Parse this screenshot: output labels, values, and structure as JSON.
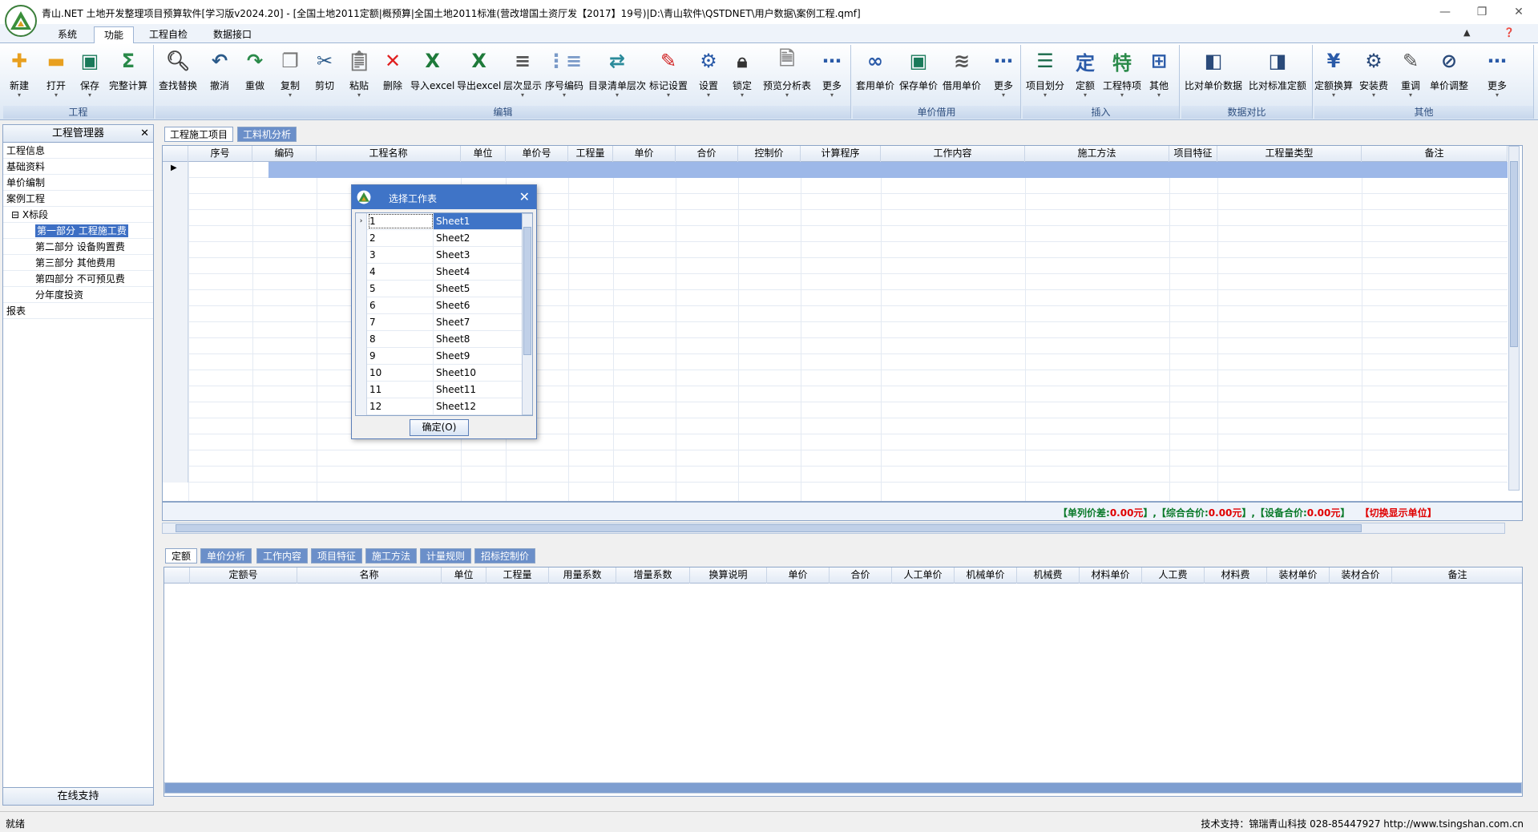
{
  "window": {
    "title": "青山.NET 土地开发整理项目预算软件[学习版v2024.20] - [全国土地2011定额|概预算|全国土地2011标准(营改增国土资厅发【2017】19号)|D:\\青山软件\\QSTDNET\\用户数据\\案例工程.qmf]",
    "minimize": "—",
    "restore": "❐",
    "close": "✕"
  },
  "menu": {
    "tabs": [
      "系统",
      "功能",
      "工程自检",
      "数据接口"
    ],
    "active": "功能",
    "right_up": "▲",
    "right_info": "❓"
  },
  "ribbon": {
    "groups": [
      {
        "label": "工程",
        "buttons": [
          "新建",
          "打开",
          "保存",
          "完整计算"
        ]
      },
      {
        "label": "编辑",
        "buttons": [
          "查找替换",
          "撤消",
          "重做",
          "复制",
          "剪切",
          "粘贴",
          "删除",
          "导入excel",
          "导出excel",
          "层次显示",
          "序号编码",
          "目录清单层次",
          "标记设置",
          "设置",
          "锁定",
          "预览分析表",
          "更多"
        ]
      },
      {
        "label": "单价借用",
        "buttons": [
          "套用单价",
          "保存单价",
          "借用单价",
          "更多"
        ]
      },
      {
        "label": "插入",
        "buttons": [
          "项目划分",
          "定额",
          "工程特项",
          "其他"
        ]
      },
      {
        "label": "数据对比",
        "buttons": [
          "比对单价数据",
          "比对标准定额"
        ]
      },
      {
        "label": "其他",
        "buttons": [
          "定额换算",
          "安装费",
          "重调",
          "单价调整",
          "更多"
        ]
      }
    ]
  },
  "left_panel": {
    "title": "工程管理器",
    "close": "✕",
    "items": [
      {
        "label": "工程信息",
        "level": 0
      },
      {
        "label": "基础资料",
        "level": 0
      },
      {
        "label": "单价编制",
        "level": 0
      },
      {
        "label": "案例工程",
        "level": 0
      },
      {
        "label": "⊟ X标段",
        "level": 0
      },
      {
        "label": "第一部分 工程施工费",
        "level": 1,
        "selected": true
      },
      {
        "label": "第二部分 设备购置费",
        "level": 1
      },
      {
        "label": "第三部分 其他费用",
        "level": 1
      },
      {
        "label": "第四部分 不可预见费",
        "level": 1
      },
      {
        "label": "分年度投资",
        "level": 1
      },
      {
        "label": "报表",
        "level": 0
      }
    ],
    "footer": "在线支持"
  },
  "doc_tabs": [
    "工程施工项目",
    "工料机分析"
  ],
  "upper_grid": {
    "columns": [
      "序号",
      "编码",
      "工程名称",
      "单位",
      "单价号",
      "工程量",
      "单价",
      "合价",
      "控制价",
      "计算程序",
      "工作内容",
      "施工方法",
      "项目特征",
      "工程量类型",
      "备注"
    ],
    "current_row_marker": "▶"
  },
  "summary": {
    "part1_label": "【单列价差:",
    "part1_value": "0.00元",
    "part2_label": "】,【综合合价:",
    "part2_value": "0.00元",
    "part3_label": "】,【设备合价:",
    "part3_value": "0.00元",
    "part4_label": "】",
    "switch_unit": "【切换显示单位】"
  },
  "lower_tabs": [
    "定额",
    "单价分析",
    "工作内容",
    "项目特征",
    "施工方法",
    "计量规则",
    "招标控制价"
  ],
  "lower_grid": {
    "columns": [
      "定额号",
      "名称",
      "单位",
      "工程量",
      "用量系数",
      "增量系数",
      "换算说明",
      "单价",
      "合价",
      "人工单价",
      "机械单价",
      "机械费",
      "材料单价",
      "人工费",
      "材料费",
      "装材单价",
      "装材合价",
      "备注"
    ]
  },
  "status": {
    "left": "就绪",
    "right": "技术支持：锦瑞青山科技 028-85447927 http://www.tsingshan.com.cn"
  },
  "dialog": {
    "title": "选择工作表",
    "close": "✕",
    "rows": [
      {
        "num": "1",
        "sheet": "Sheet1"
      },
      {
        "num": "2",
        "sheet": "Sheet2"
      },
      {
        "num": "3",
        "sheet": "Sheet3"
      },
      {
        "num": "4",
        "sheet": "Sheet4"
      },
      {
        "num": "5",
        "sheet": "Sheet5"
      },
      {
        "num": "6",
        "sheet": "Sheet6"
      },
      {
        "num": "7",
        "sheet": "Sheet7"
      },
      {
        "num": "8",
        "sheet": "Sheet8"
      },
      {
        "num": "9",
        "sheet": "Sheet9"
      },
      {
        "num": "10",
        "sheet": "Sheet10"
      },
      {
        "num": "11",
        "sheet": "Sheet11"
      },
      {
        "num": "12",
        "sheet": "Sheet12"
      }
    ],
    "selected_row_marker": "›",
    "ok_button": "确定(O)"
  },
  "colors": {
    "accent": "#3f74c7",
    "summary_green": "#0a7a2a",
    "summary_red": "#e00000"
  }
}
